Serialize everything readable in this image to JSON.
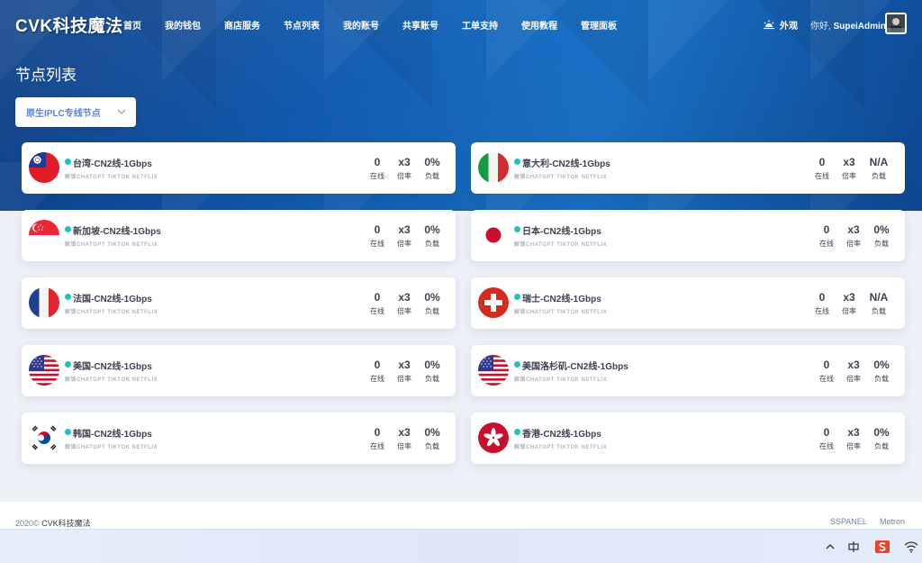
{
  "brand": "CVK科技魔法",
  "nav": [
    "首页",
    "我的钱包",
    "商店服务",
    "节点列表",
    "我的账号",
    "共享账号",
    "工单支持",
    "使用教程",
    "管理面板"
  ],
  "appearance": "外观",
  "user": {
    "greeting": "你好,",
    "name": "SupeiAdmin"
  },
  "page_title": "节点列表",
  "filter": {
    "selected": "原生IPLC专线节点"
  },
  "stat_labels": {
    "online": "在线",
    "rate": "倍率",
    "load": "负载"
  },
  "nodes": [
    {
      "name": "台湾-CN2线-1Gbps",
      "tags": "解锁CHATGPT TIKTOK NETFLIX",
      "flag": "taiwan-flag-icon",
      "online": "0",
      "rate": "x3",
      "load": "0%"
    },
    {
      "name": "意大利-CN2线-1Gbps",
      "tags": "解锁CHATGPT TIKTOK NETFLIX",
      "flag": "italy-flag-icon",
      "online": "0",
      "rate": "x3",
      "load": "N/A"
    },
    {
      "name": "新加坡-CN2线-1Gbps",
      "tags": "解锁CHATGPT TIKTOK NETFLIX",
      "flag": "singapore-flag-icon",
      "online": "0",
      "rate": "x3",
      "load": "0%"
    },
    {
      "name": "日本-CN2线-1Gbps",
      "tags": "解锁CHATGPT TIKTOK NETFLIX",
      "flag": "japan-flag-icon",
      "online": "0",
      "rate": "x3",
      "load": "0%"
    },
    {
      "name": "法国-CN2线-1Gbps",
      "tags": "解锁CHATGPT TIKTOK NETFLIX",
      "flag": "france-flag-icon",
      "online": "0",
      "rate": "x3",
      "load": "0%"
    },
    {
      "name": "瑞士-CN2线-1Gbps",
      "tags": "解锁CHATGPT TIKTOK NETFLIX",
      "flag": "switzerland-flag-icon",
      "online": "0",
      "rate": "x3",
      "load": "N/A"
    },
    {
      "name": "美国-CN2线-1Gbps",
      "tags": "解锁CHATGPT TIKTOK NETFLIX",
      "flag": "usa-flag-icon",
      "online": "0",
      "rate": "x3",
      "load": "0%"
    },
    {
      "name": "美国洛杉矶-CN2线-1Gbps",
      "tags": "解锁CHATGPT TIKTOK NETFLIX",
      "flag": "usa-flag-icon",
      "online": "0",
      "rate": "x3",
      "load": "0%"
    },
    {
      "name": "韩国-CN2线-1Gbps",
      "tags": "解锁CHATGPT TIKTOK NETFLIX",
      "flag": "korea-flag-icon",
      "online": "0",
      "rate": "x3",
      "load": "0%"
    },
    {
      "name": "香港-CN2线-1Gbps",
      "tags": "解锁CHATGPT TIKTOK NETFLIX",
      "flag": "hongkong-flag-icon",
      "online": "0",
      "rate": "x3",
      "load": "0%"
    }
  ],
  "footer": {
    "year": "2020©",
    "brand": "CVK科技魔法",
    "links": [
      "SSPANEL",
      "Metron"
    ]
  },
  "colors": {
    "accent": "#1bc5bd",
    "hero": "#125bb0",
    "link": "#5c84d6"
  },
  "taskbar": [
    "chevron-up-icon",
    "input-method-icon",
    "app-s-icon",
    "wifi-icon"
  ]
}
